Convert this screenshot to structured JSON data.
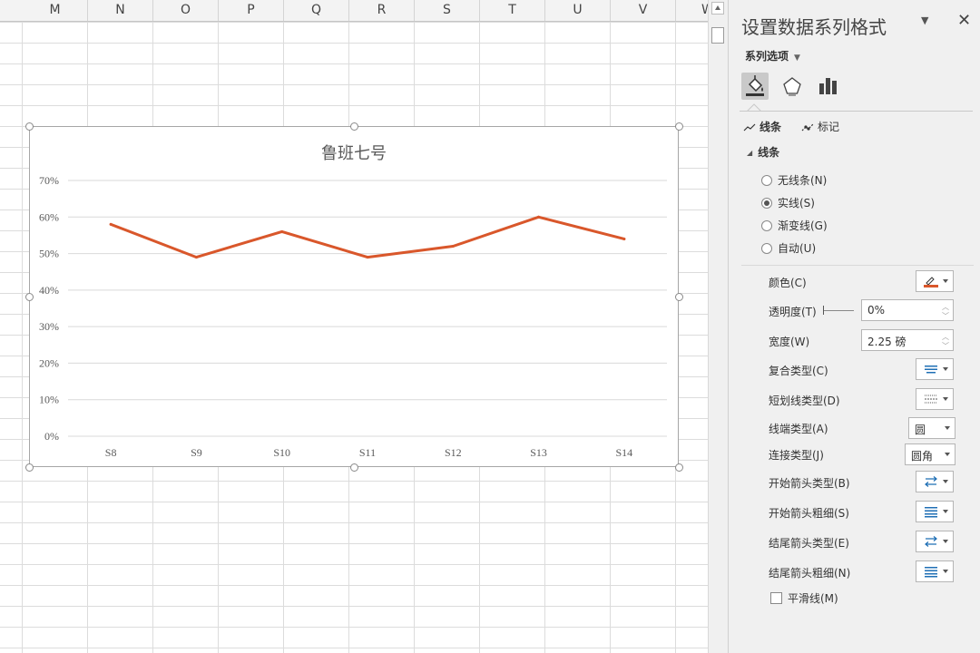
{
  "columns": [
    "M",
    "N",
    "O",
    "P",
    "Q",
    "R",
    "S",
    "T",
    "U",
    "V",
    "W"
  ],
  "chart": {
    "title": "鲁班七号"
  },
  "chart_data": {
    "type": "line",
    "title": "鲁班七号",
    "categories": [
      "S8",
      "S9",
      "S10",
      "S11",
      "S12",
      "S13",
      "S14"
    ],
    "series": [
      {
        "values": [
          58,
          49,
          56,
          49,
          52,
          60,
          54
        ],
        "color": "#d9572b"
      }
    ],
    "y_ticks": [
      "0%",
      "10%",
      "20%",
      "30%",
      "40%",
      "50%",
      "60%",
      "70%"
    ],
    "ylim": [
      0,
      70
    ],
    "y_unit": "percent",
    "grid": "horizontal",
    "legend": "none"
  },
  "pane": {
    "title": "设置数据系列格式",
    "series_options": "系列选项",
    "tabs": [
      "fill-and-line",
      "effects",
      "series-options"
    ],
    "subtabs": {
      "line": "线条",
      "marker": "标记"
    },
    "section": "线条",
    "radios": [
      {
        "label": "无线条(N)",
        "checked": false
      },
      {
        "label": "实线(S)",
        "checked": true
      },
      {
        "label": "渐变线(G)",
        "checked": false
      },
      {
        "label": "自动(U)",
        "checked": false
      }
    ],
    "color_label": "颜色(C)",
    "line_color": "#d9572b",
    "transparency_label": "透明度(T)",
    "transparency_value": "0%",
    "width_label": "宽度(W)",
    "width_value": "2.25 磅",
    "compound_label": "复合类型(C)",
    "dash_label": "短划线类型(D)",
    "cap_label": "线端类型(A)",
    "cap_value": "圆",
    "join_label": "连接类型(J)",
    "join_value": "圆角",
    "begin_arrow_type_label": "开始箭头类型(B)",
    "begin_arrow_size_label": "开始箭头粗细(S)",
    "end_arrow_type_label": "结尾箭头类型(E)",
    "end_arrow_size_label": "结尾箭头粗细(N)",
    "smooth_label": "平滑线(M)",
    "smooth_checked": false
  }
}
